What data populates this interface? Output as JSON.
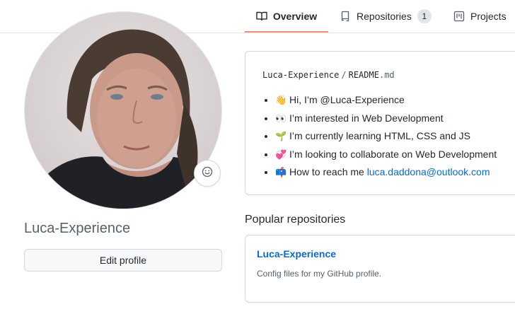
{
  "nav": {
    "tabs": [
      {
        "label": "Overview",
        "icon": "book-icon",
        "selected": true
      },
      {
        "label": "Repositories",
        "icon": "repo-icon",
        "count": "1"
      },
      {
        "label": "Projects",
        "icon": "project-icon"
      }
    ],
    "accent_color": "#fd8c73"
  },
  "profile": {
    "username": "Luca-Experience",
    "edit_label": "Edit profile",
    "status_icon": "smiley-icon"
  },
  "readme": {
    "owner": "Luca-Experience",
    "separator": "/",
    "file": "README",
    "ext": ".md",
    "items": [
      {
        "emoji": "👋",
        "text": "Hi, I’m @Luca-Experience"
      },
      {
        "emoji": "👀",
        "text": "I’m interested in Web Development"
      },
      {
        "emoji": "🌱",
        "text": "I’m currently learning HTML, CSS and JS"
      },
      {
        "emoji": "💞",
        "text": "I’m looking to collaborate on Web Development"
      },
      {
        "emoji": "📫",
        "text": "How to reach me ",
        "link": "luca.daddona@outlook.com"
      }
    ]
  },
  "popular": {
    "title": "Popular repositories",
    "repos": [
      {
        "name": "Luca-Experience",
        "description": "Config files for my GitHub profile."
      }
    ]
  },
  "colors": {
    "link": "#0969da",
    "border": "#d0d7de"
  }
}
